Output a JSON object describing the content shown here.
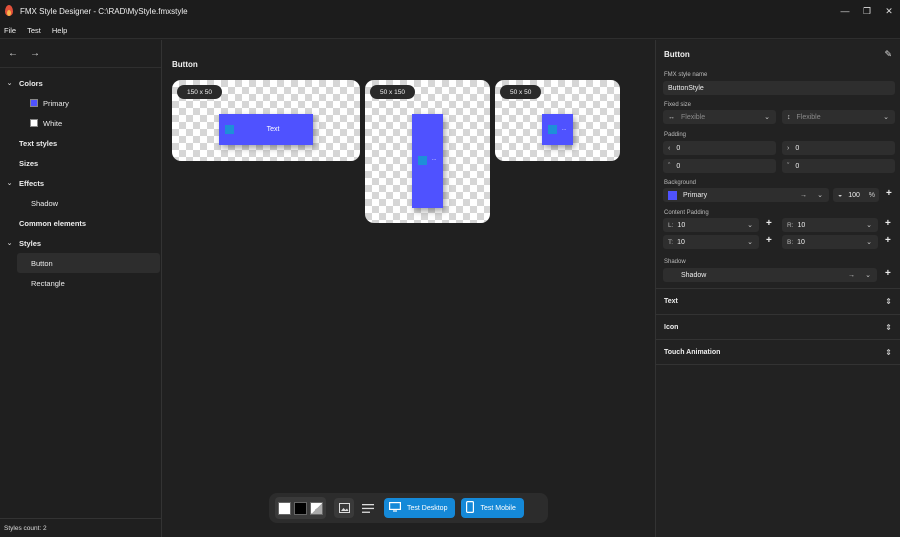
{
  "window": {
    "title": "FMX Style Designer - C:\\RAD\\MyStyle.fmxstyle",
    "minimize": "—",
    "restore": "❐",
    "close": "✕"
  },
  "menu": [
    "File",
    "Test",
    "Help"
  ],
  "nav": {
    "back": "←",
    "forward": "→"
  },
  "tree": [
    {
      "label": "Colors",
      "type": "group"
    },
    {
      "label": "Primary",
      "type": "color",
      "color": "#4f52ff"
    },
    {
      "label": "White",
      "type": "color",
      "color": "#ffffff"
    },
    {
      "label": "Text styles",
      "type": "group"
    },
    {
      "label": "Sizes",
      "type": "group"
    },
    {
      "label": "Effects",
      "type": "group"
    },
    {
      "label": "Shadow",
      "type": "child"
    },
    {
      "label": "Common elements",
      "type": "group"
    },
    {
      "label": "Styles",
      "type": "group"
    },
    {
      "label": "Button",
      "type": "child",
      "selected": true
    },
    {
      "label": "Rectangle",
      "type": "child"
    }
  ],
  "status": "Styles count: 2",
  "preview": {
    "title": "Button",
    "cards": [
      {
        "size_label": "150 x 50",
        "button_text": "Text"
      },
      {
        "size_label": "50 x 150",
        "button_text": "..."
      },
      {
        "size_label": "50 x 50",
        "button_text": "..."
      }
    ]
  },
  "toolbar": {
    "test_desktop": "Test Desktop",
    "test_mobile": "Test Mobile"
  },
  "props": {
    "header": "Button",
    "style_name_label": "FMX style name",
    "style_name_value": "ButtonStyle",
    "fixed_size_label": "Fixed size",
    "fixed_w": "Flexible",
    "fixed_h": "Flexible",
    "padding_label": "Padding",
    "padding": [
      "0",
      "0",
      "0",
      "0"
    ],
    "background_label": "Background",
    "background_value": "Primary",
    "background_color": "#4f52ff",
    "opacity": "100",
    "opacity_unit": "%",
    "content_padding_label": "Content Padding",
    "cp": [
      {
        "side": "L:",
        "value": "10"
      },
      {
        "side": "R:",
        "value": "10"
      },
      {
        "side": "T:",
        "value": "10"
      },
      {
        "side": "B:",
        "value": "10"
      }
    ],
    "shadow_label": "Shadow",
    "shadow_value": "Shadow",
    "sections": [
      "Text",
      "Icon",
      "Touch Animation"
    ]
  }
}
